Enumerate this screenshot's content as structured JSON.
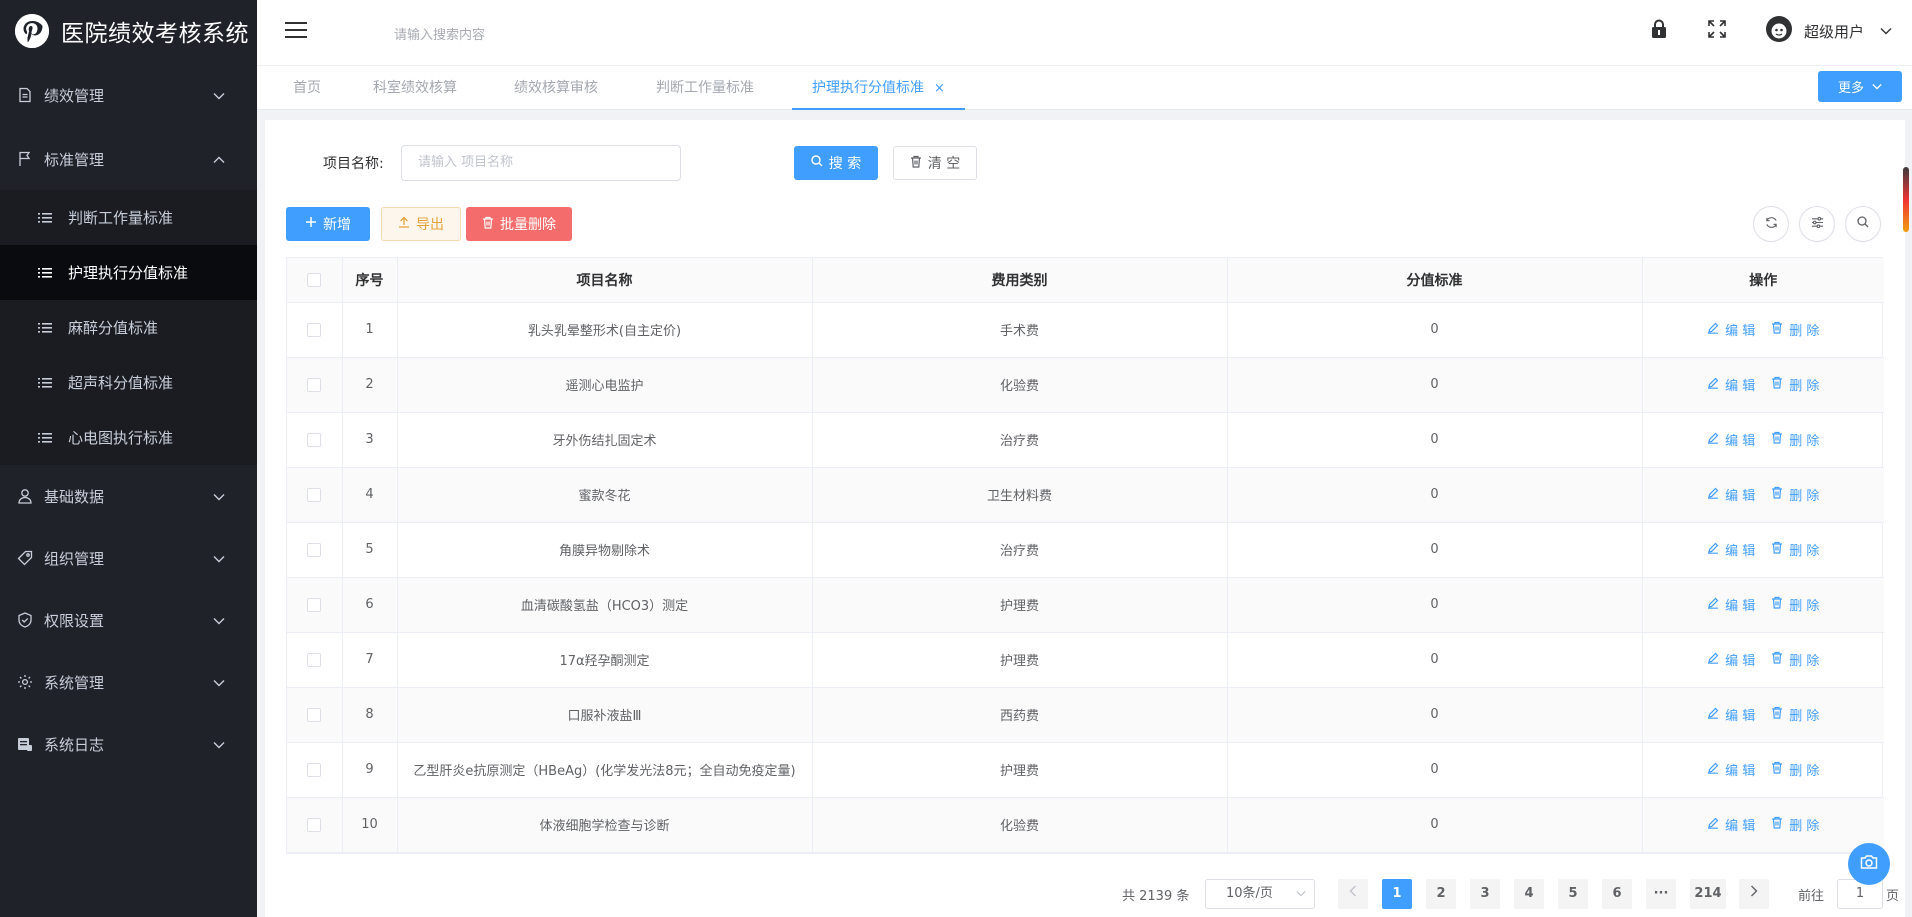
{
  "app": {
    "title": "医院绩效考核系统",
    "logo_letter": "p"
  },
  "sidebar": {
    "menu": [
      {
        "label": "绩效管理",
        "icon": "document-icon"
      },
      {
        "label": "标准管理",
        "icon": "flag-icon"
      },
      {
        "label": "基础数据",
        "icon": "user-icon"
      },
      {
        "label": "组织管理",
        "icon": "tag-icon"
      },
      {
        "label": "权限设置",
        "icon": "shield-icon"
      },
      {
        "label": "系统管理",
        "icon": "gear-icon"
      },
      {
        "label": "系统日志",
        "icon": "log-icon"
      }
    ],
    "submenu": [
      {
        "label": "判断工作量标准"
      },
      {
        "label": "护理执行分值标准"
      },
      {
        "label": "麻醉分值标准"
      },
      {
        "label": "超声科分值标准"
      },
      {
        "label": "心电图执行标准"
      }
    ]
  },
  "header": {
    "search_placeholder": "请输入搜索内容",
    "user_name": "超级用户"
  },
  "tabs": [
    {
      "label": "首页"
    },
    {
      "label": "科室绩效核算"
    },
    {
      "label": "绩效核算审核"
    },
    {
      "label": "判断工作量标准"
    },
    {
      "label": "护理执行分值标准",
      "close": "×"
    }
  ],
  "more_label": "更多",
  "filter": {
    "label": "项目名称:",
    "placeholder": "请输入 项目名称",
    "search_label": "搜 索",
    "clear_label": "清 空"
  },
  "toolbar": {
    "add_label": "新增",
    "export_label": "导出",
    "batch_delete_label": "批量删除"
  },
  "table": {
    "columns": [
      "序号",
      "项目名称",
      "费用类别",
      "分值标准",
      "操作"
    ],
    "rows": [
      {
        "no": "1",
        "name": "乳头乳晕整形术(自主定价)",
        "category": "手术费",
        "score": "0"
      },
      {
        "no": "2",
        "name": "遥测心电监护",
        "category": "化验费",
        "score": "0"
      },
      {
        "no": "3",
        "name": "牙外伤结扎固定术",
        "category": "治疗费",
        "score": "0"
      },
      {
        "no": "4",
        "name": "蜜款冬花",
        "category": "卫生材料费",
        "score": "0"
      },
      {
        "no": "5",
        "name": "角膜异物剔除术",
        "category": "治疗费",
        "score": "0"
      },
      {
        "no": "6",
        "name": "血清碳酸氢盐（HCO3）测定",
        "category": "护理费",
        "score": "0"
      },
      {
        "no": "7",
        "name": "17α羟孕酮测定",
        "category": "护理费",
        "score": "0"
      },
      {
        "no": "8",
        "name": "口服补液盐Ⅲ",
        "category": "西药费",
        "score": "0"
      },
      {
        "no": "9",
        "name": "乙型肝炎e抗原测定（HBeAg）(化学发光法8元；全自动免疫定量)",
        "category": "护理费",
        "score": "0"
      },
      {
        "no": "10",
        "name": "体液细胞学检查与诊断",
        "category": "化验费",
        "score": "0"
      }
    ],
    "edit_label": "编 辑",
    "delete_label": "删 除"
  },
  "pagination": {
    "total_text": "共 2139 条",
    "page_size": "10条/页",
    "pages": [
      "1",
      "2",
      "3",
      "4",
      "5",
      "6",
      "···",
      "214"
    ],
    "goto_label": "前往",
    "goto_value": "1",
    "page_suffix": "页"
  },
  "colors": {
    "primary": "#409eff",
    "danger": "#f56c6c",
    "warning": "#e6a23c",
    "sidebar": "#20222a"
  }
}
